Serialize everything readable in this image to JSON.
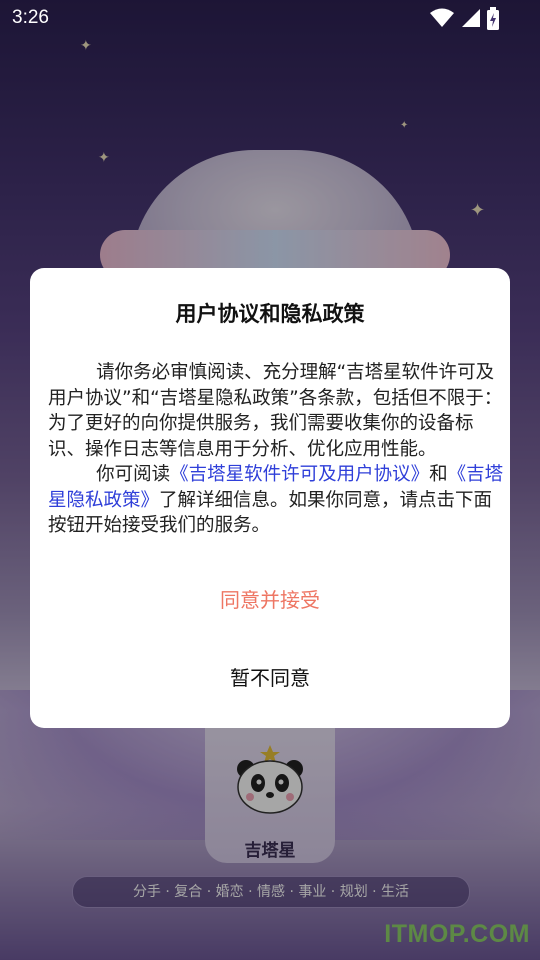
{
  "status_bar": {
    "time": "3:26",
    "icons": [
      "wifi-icon",
      "signal-icon",
      "battery-icon"
    ]
  },
  "background": {
    "brand_name": "吉塔星",
    "tags": "分手 · 复合 · 婚恋  · 情感 · 事业 · 规划 · 生活",
    "watermark": "ITMOP.COM"
  },
  "dialog": {
    "title": "用户协议和隐私政策",
    "para1": "请你务必审慎阅读、充分理解“吉塔星软件许可及用户协议”和“吉塔星隐私政策”各条款，包括但不限于：为了更好的向你提供服务，我们需要收集你的设备标识、操作日志等信息用于分析、优化应用性能。",
    "para2_prefix": "你可阅读",
    "link_user_agreement": "《吉塔星软件许可及用户协议》",
    "para2_and": "和",
    "link_privacy_policy": "《吉塔星隐私政策》",
    "para2_suffix": "了解详细信息。如果你同意，请点击下面按钮开始接受我们的服务。",
    "agree_label": "同意并接受",
    "disagree_label": "暂不同意"
  },
  "colors": {
    "agree": "#ee7663",
    "link": "#2f3fd9"
  }
}
